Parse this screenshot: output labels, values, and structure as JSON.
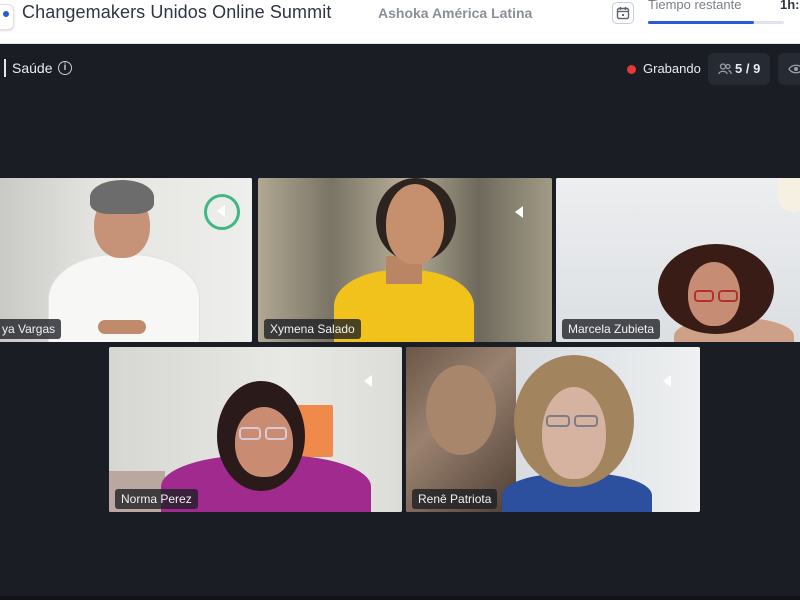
{
  "header": {
    "event_title": "Changemakers Unidos Online Summit",
    "organization": "Ashoka América Latina",
    "timer_label": "Tiempo restante",
    "timer_value": "1h:",
    "timer_progress": 0.78,
    "calendar_icon": "calendar-icon"
  },
  "stage": {
    "room_name": "Saúde",
    "info_icon": "info-icon",
    "recording_label": "Grabando",
    "participants_count": "5 / 9",
    "people_icon": "people-icon",
    "eye_icon": "eye-icon",
    "colors": {
      "recording": "#e53935",
      "speaking_ring": "#3fb885",
      "background": "#1a1d24"
    }
  },
  "participants": [
    {
      "name": "ya Vargas",
      "speaking": true
    },
    {
      "name": "Xymena Salado",
      "speaking": false
    },
    {
      "name": "Marcela Zubieta",
      "speaking": false
    },
    {
      "name": "Norma Perez",
      "speaking": false
    },
    {
      "name": "Renê Patriota",
      "speaking": false
    }
  ]
}
